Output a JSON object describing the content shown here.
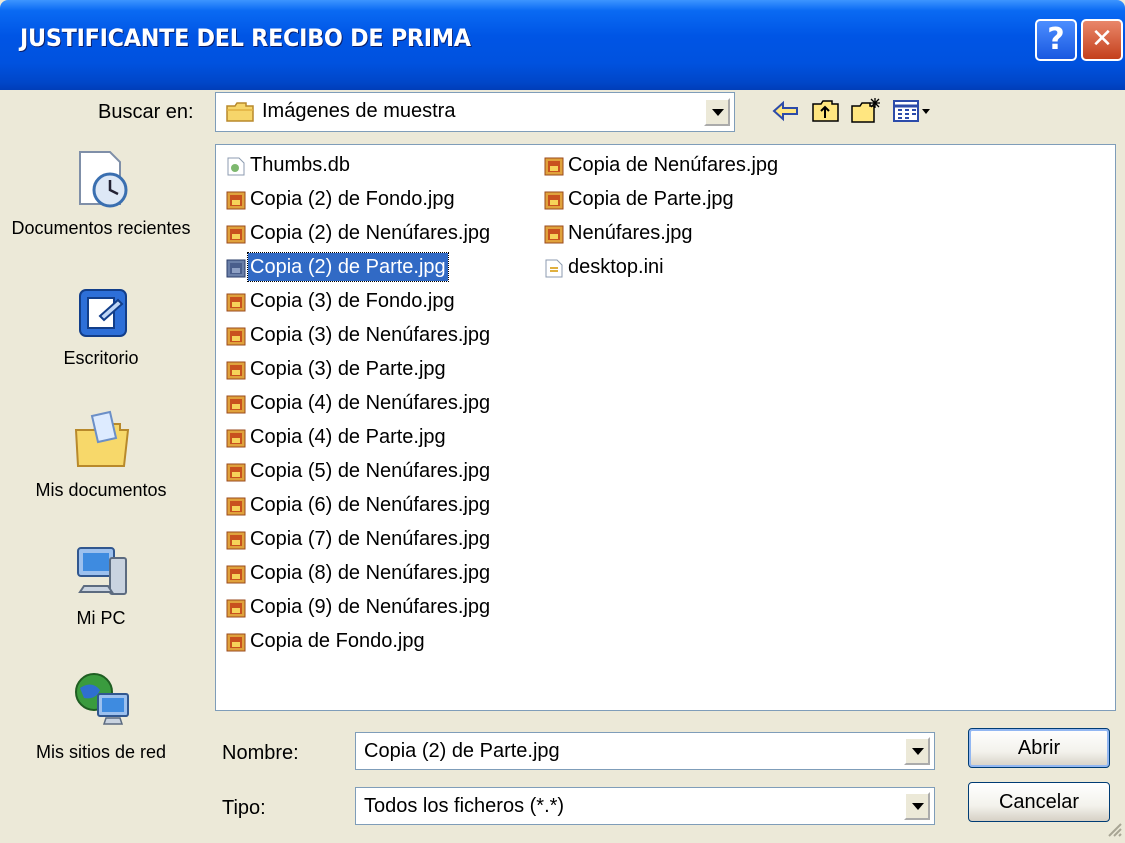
{
  "window": {
    "title": "JUSTIFICANTE DEL RECIBO DE PRIMA",
    "help_glyph": "?",
    "close_glyph": "✕"
  },
  "lookin": {
    "label": "Buscar en:",
    "value": "Imágenes de muestra"
  },
  "toolbar": {
    "icons": [
      "back-icon",
      "up-folder-icon",
      "new-folder-icon",
      "view-menu-icon"
    ]
  },
  "places": [
    {
      "label": "Documentos recientes",
      "icon": "recent-documents-icon"
    },
    {
      "label": "Escritorio",
      "icon": "desktop-icon"
    },
    {
      "label": "Mis documentos",
      "icon": "my-documents-icon"
    },
    {
      "label": "Mi PC",
      "icon": "my-computer-icon"
    },
    {
      "label": "Mis sitios de red",
      "icon": "network-places-icon"
    }
  ],
  "files_col1": [
    "Thumbs.db",
    "Copia (2) de Fondo.jpg",
    "Copia (2) de Nenúfares.jpg",
    "Copia (2) de Parte.jpg",
    "Copia (3) de Fondo.jpg",
    "Copia (3) de Nenúfares.jpg",
    "Copia (3) de Parte.jpg",
    "Copia (4) de Nenúfares.jpg",
    "Copia (4) de Parte.jpg",
    "Copia (5) de Nenúfares.jpg",
    "Copia (6) de Nenúfares.jpg",
    "Copia (7) de Nenúfares.jpg",
    "Copia (8) de Nenúfares.jpg",
    "Copia (9) de Nenúfares.jpg",
    "Copia de Fondo.jpg"
  ],
  "files_col2": [
    "Copia de Nenúfares.jpg",
    "Copia de Parte.jpg",
    "Nenúfares.jpg",
    "desktop.ini"
  ],
  "selected_file": "Copia (2) de Parte.jpg",
  "filename": {
    "label": "Nombre:",
    "value": "Copia (2) de Parte.jpg"
  },
  "filetype": {
    "label": "Tipo:",
    "value": "Todos los ficheros (*.*)"
  },
  "buttons": {
    "open": "Abrir",
    "cancel": "Cancelar"
  },
  "colors": {
    "title_bar": "#0055E5",
    "face": "#ECE9D8",
    "selection": "#316AC5"
  }
}
